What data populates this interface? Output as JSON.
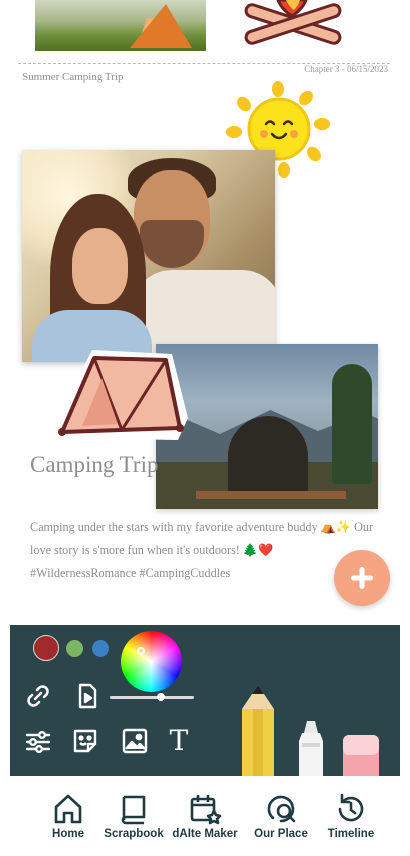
{
  "page": {
    "chapter": "Chapter 3 - 06/15/2023",
    "album_title": "Summer Camping Trip",
    "section_title": "Camping Trip",
    "caption": "Camping under the stars with my favorite adventure buddy ⛺✨ Our love story is s'more fun when it's outdoors! 🌲❤️ #WildernessRomance #CampingCuddles"
  },
  "stickers": {
    "campfire": "campfire-sticker",
    "sun": "sun-sticker",
    "tent": "tent-sticker"
  },
  "toolbar": {
    "colors": [
      "#a12a2a",
      "#7bb662",
      "#3b7fc4"
    ],
    "brush_size": 0.62,
    "text_tool_label": "T",
    "tools": [
      "link-icon",
      "video-file-icon",
      "sliders-icon",
      "sticker-icon",
      "image-icon",
      "text-icon",
      "pencil-icon",
      "marker-icon",
      "eraser-icon"
    ]
  },
  "fab": {
    "icon": "plus-icon"
  },
  "nav": {
    "items": [
      {
        "label": "Home",
        "icon": "home-icon"
      },
      {
        "label": "Scrapbook",
        "icon": "book-icon"
      },
      {
        "label": "dAIte Maker",
        "icon": "calendar-icon"
      },
      {
        "label": "Our Place",
        "icon": "map-search-icon"
      },
      {
        "label": "Timeline",
        "icon": "history-icon"
      }
    ]
  },
  "colors": {
    "toolbar_bg": "#2b454b",
    "accent": "#f6a582",
    "nav_text": "#1f3a40"
  }
}
